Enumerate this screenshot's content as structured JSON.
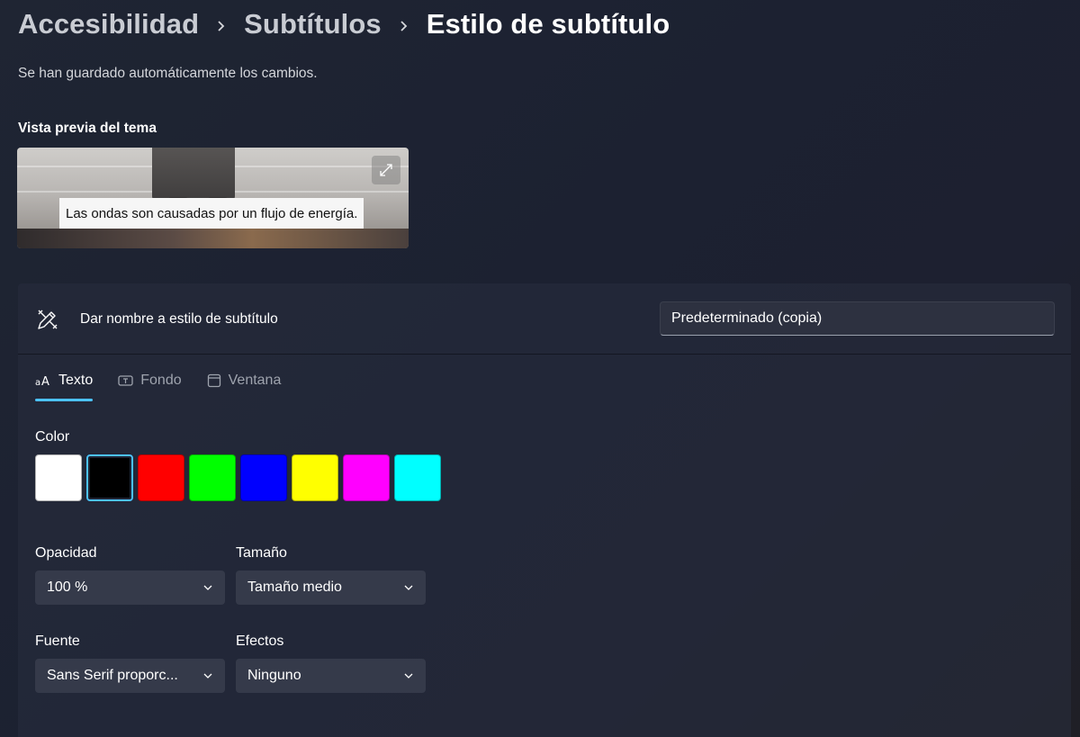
{
  "breadcrumb": {
    "items": [
      "Accesibilidad",
      "Subtítulos",
      "Estilo de subtítulo"
    ]
  },
  "autosave_text": "Se han guardado automáticamente los cambios.",
  "preview": {
    "title": "Vista previa del tema",
    "caption": "Las ondas son causadas por un flujo de energía.",
    "expand_icon": "expand-icon"
  },
  "panel": {
    "name_label": "Dar nombre a estilo de subtítulo",
    "name_value": "Predeterminado (copia)",
    "tabs": [
      {
        "label": "Texto",
        "icon": "text-size-icon",
        "active": true
      },
      {
        "label": "Fondo",
        "icon": "background-icon",
        "active": false
      },
      {
        "label": "Ventana",
        "icon": "window-icon",
        "active": false
      }
    ],
    "color_label": "Color",
    "colors": [
      "#ffffff",
      "#000000",
      "#ff0000",
      "#00ff00",
      "#0000ff",
      "#ffff00",
      "#ff00ff",
      "#00ffff"
    ],
    "selected_color": "#000000",
    "fields": {
      "opacity": {
        "label": "Opacidad",
        "value": "100 %"
      },
      "size": {
        "label": "Tamaño",
        "value": "Tamaño medio"
      },
      "font": {
        "label": "Fuente",
        "value": "Sans Serif proporc..."
      },
      "effects": {
        "label": "Efectos",
        "value": "Ninguno"
      }
    }
  },
  "accent_color": "#4cc2ff"
}
